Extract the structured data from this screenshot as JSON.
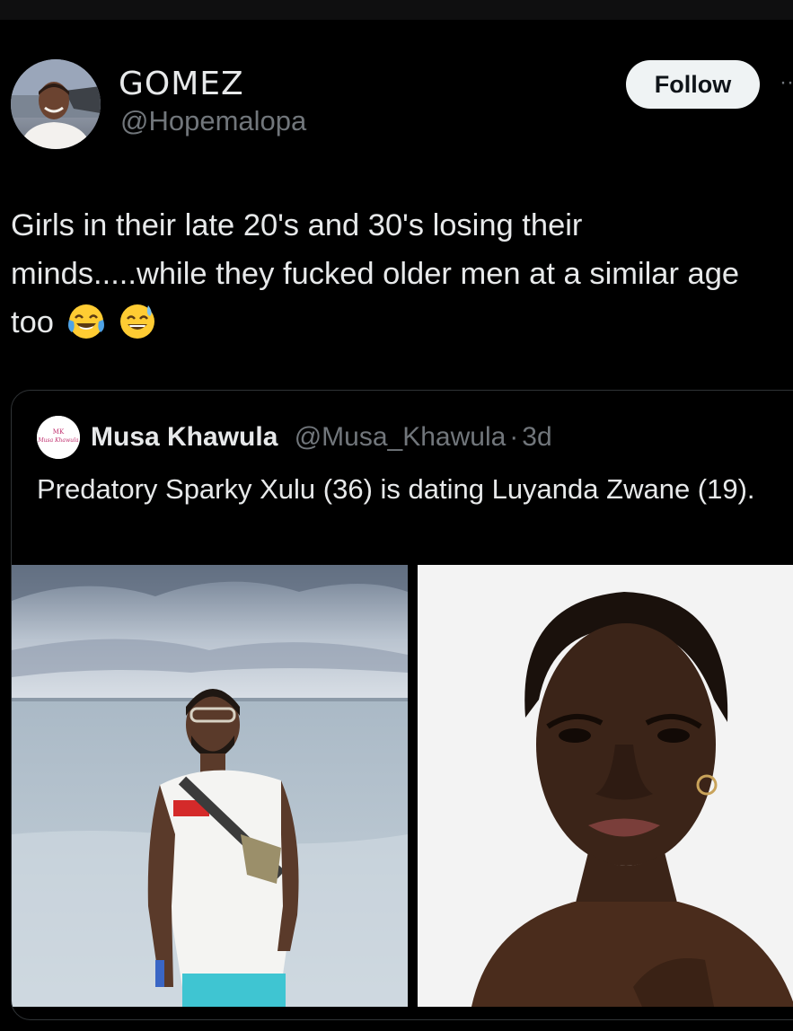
{
  "tweet": {
    "author": {
      "display_name": "GOMEZ",
      "handle": "@Hopemalopa"
    },
    "follow_label": "Follow",
    "more_icon": "more-dots-icon",
    "text": "Girls in their late 20's and 30's losing their minds.....while they fucked older men at a similar age too",
    "emojis": [
      "face-with-tears-of-joy",
      "grinning-face-with-sweat"
    ]
  },
  "quoted_tweet": {
    "author_name": "Musa Khawula",
    "author_handle": "@Musa_Khawula",
    "separator": "·",
    "time": "3d",
    "text": "Predatory Sparky Xulu (36) is dating Luyanda Zwane (19).",
    "media": [
      {
        "kind": "photo",
        "subject": "man on beach"
      },
      {
        "kind": "photo",
        "subject": "woman portrait"
      }
    ]
  },
  "colors": {
    "background": "#000000",
    "text_primary": "#e7e9ea",
    "text_secondary": "#71767b",
    "border": "#2f3336",
    "follow_bg": "#eff3f4"
  }
}
